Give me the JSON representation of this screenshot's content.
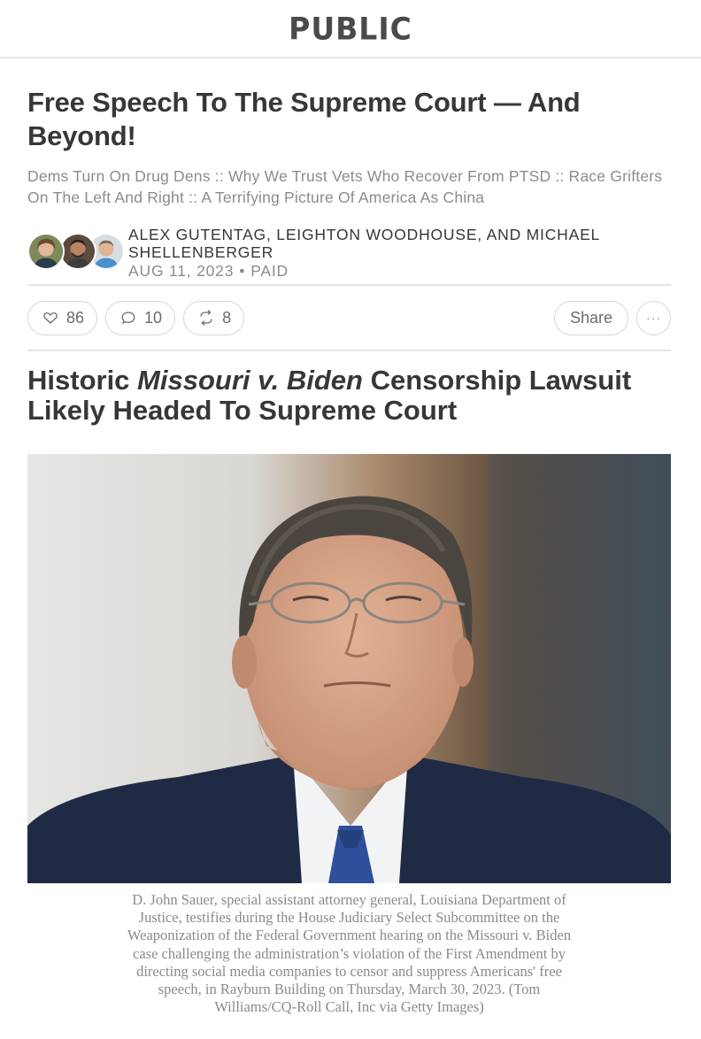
{
  "publication": {
    "name": "PUBLIC"
  },
  "post": {
    "title": "Free Speech To The Supreme Court — And Beyond!",
    "subtitle": "Dems Turn On Drug Dens :: Why We Trust Vets Who Recover From PTSD :: Race Grifters On The Left And Right :: A Terrifying Picture Of America As China",
    "authors": "ALEX GUTENTAG, LEIGHTON WOODHOUSE, AND MICHAEL SHELLENBERGER",
    "date": "AUG 11, 2023",
    "access": "PAID"
  },
  "actions": {
    "likes": "86",
    "comments": "10",
    "restacks": "8",
    "share_label": "Share",
    "more_label": "···"
  },
  "section": {
    "headline_before": "Historic ",
    "headline_italic": "Missouri v. Biden",
    "headline_after": " Censorship Lawsuit Likely Headed To Supreme Court"
  },
  "image": {
    "caption": "D. John Sauer, special assistant attorney general, Louisiana Department of Justice, testifies during the House Judiciary Select Subcommittee on the Weaponization of the Federal Government hearing on the Missouri v. Biden case challenging the administration’s violation of the First Amendment by directing social media companies to censor and suppress Americans' free speech, in Rayburn Building on Thursday, March 30, 2023. (Tom Williams/CQ-Roll Call, Inc via Getty Images)"
  },
  "icons": {
    "like": "heart-icon",
    "comment": "comment-bubble-icon",
    "restack": "restack-arrows-icon",
    "more": "ellipsis-icon"
  },
  "colors": {
    "text": "#363737",
    "muted": "#8c8c8c",
    "border": "#d6d6d6"
  }
}
